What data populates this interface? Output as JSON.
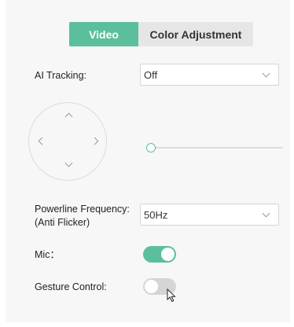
{
  "tabs": [
    {
      "label": "Video",
      "active": true
    },
    {
      "label": "Color Adjustment",
      "active": false
    }
  ],
  "ai_tracking": {
    "label": "AI Tracking:",
    "value": "Off"
  },
  "pan_tilt": {
    "slider_value": 0
  },
  "powerline": {
    "label_line1": "Powerline Frequency:",
    "label_line2": "(Anti Flicker)",
    "value": "50Hz"
  },
  "mic": {
    "label": "Mic：",
    "on": true
  },
  "gesture": {
    "label": "Gesture Control:",
    "on": false
  },
  "colors": {
    "accent": "#5bbf9b",
    "toggle_off": "#d5d5d5",
    "panel_bg": "#f7f7f7"
  },
  "icons": [
    "chevron-up-icon",
    "chevron-down-icon",
    "chevron-left-icon",
    "chevron-right-icon",
    "mouse-cursor-icon"
  ]
}
